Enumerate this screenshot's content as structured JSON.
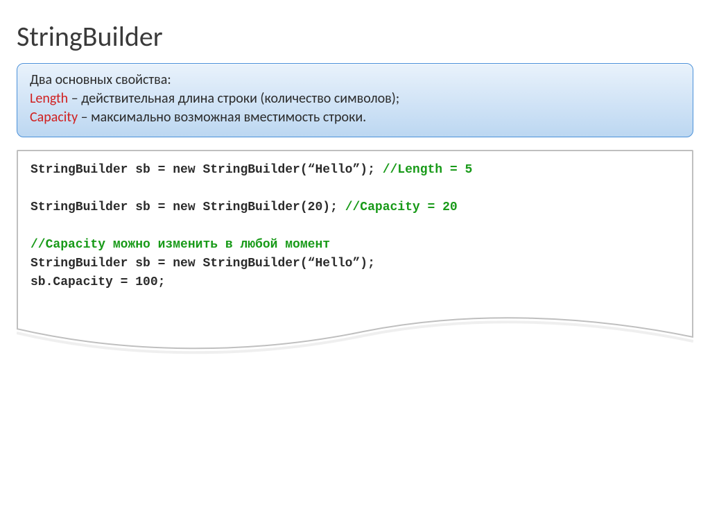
{
  "title": "StringBuilder",
  "info": {
    "intro": "Два основных свойства:",
    "length_kw": "Length",
    "length_desc": " – действительная длина строки (количество символов);",
    "capacity_kw": "Capacity",
    "capacity_desc": " – максимально возможная вместимость строки."
  },
  "code": {
    "l1a": "StringBuilder sb = new StringBuilder(“Hello”); ",
    "l1c": "//Length = 5",
    "l2": "",
    "l3a": "StringBuilder sb = new StringBuilder(20); ",
    "l3c": "//Capacity = 20",
    "l4": "",
    "l5c": "//Capacity можно изменить в любой момент",
    "l6": "StringBuilder sb = new StringBuilder(“Hello”);",
    "l7": "sb.Capacity = 100;"
  }
}
